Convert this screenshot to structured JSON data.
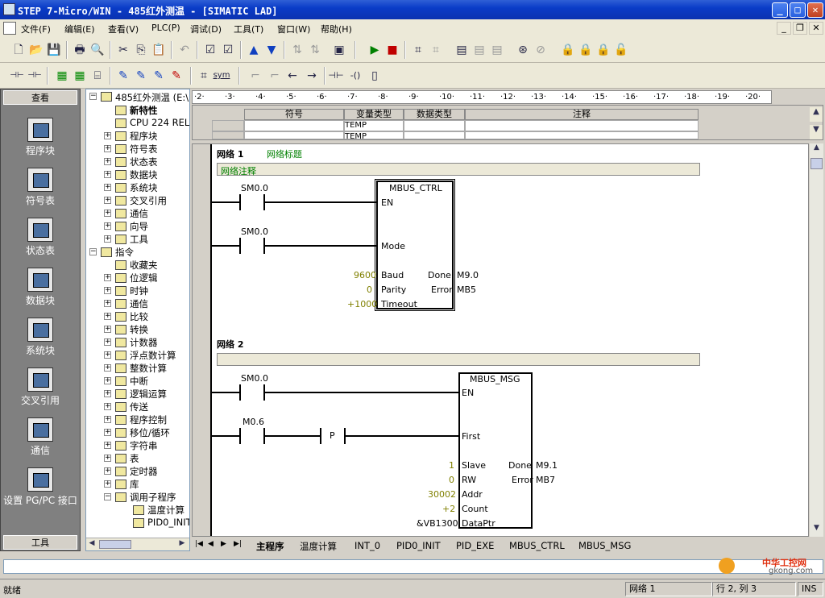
{
  "window": {
    "title": "STEP 7-Micro/WIN - 485红外测温 - [SIMATIC LAD]",
    "min": "_",
    "max": "□",
    "close": "✕"
  },
  "menu": [
    "文件(F)",
    "编辑(E)",
    "查看(V)",
    "PLC(P)",
    "调试(D)",
    "工具(T)",
    "窗口(W)",
    "帮助(H)"
  ],
  "toolbar2": {
    "sym": "sym"
  },
  "nav": {
    "header": "查看",
    "footer": "工具",
    "items": [
      "程序块",
      "符号表",
      "状态表",
      "数据块",
      "系统块",
      "交叉引用",
      "通信",
      "设置 PG/PC 接口"
    ]
  },
  "tree": {
    "root": "485红外测温 (E:\\",
    "items": [
      "新特性",
      "CPU 224 REL",
      "程序块",
      "符号表",
      "状态表",
      "数据块",
      "系统块",
      "交叉引用",
      "通信",
      "向导",
      "工具",
      "指令",
      "收藏夹",
      "位逻辑",
      "时钟",
      "通信",
      "比较",
      "转换",
      "计数器",
      "浮点数计算",
      "整数计算",
      "中断",
      "逻辑运算",
      "传送",
      "程序控制",
      "移位/循环",
      "字符串",
      "表",
      "定时器",
      "库",
      "调用子程序",
      "温度计算",
      "PID0_INIT"
    ]
  },
  "ruler": [
    "·2·",
    "·3·",
    "·4·",
    "·5·",
    "·6·",
    "·7·",
    "·8·",
    "·9·",
    "·10·",
    "·11·",
    "·12·",
    "·13·",
    "·14·",
    "·15·",
    "·16·",
    "·17·",
    "·18·",
    "·19·",
    "·20·"
  ],
  "symtable": {
    "headers": [
      "符号",
      "变量类型",
      "数据类型",
      "注释"
    ],
    "rows": [
      [
        "",
        "TEMP",
        "",
        ""
      ],
      [
        "",
        "TEMP",
        "",
        ""
      ]
    ]
  },
  "network1": {
    "label": "网络 1",
    "title": "网络标题",
    "comment": "网络注释",
    "contact1": "SM0.0",
    "contact2": "SM0.0",
    "block": "MBUS_CTRL",
    "en": "EN",
    "mode": "Mode",
    "baud": "Baud",
    "parity": "Parity",
    "timeout": "Timeout",
    "done": "Done",
    "error": "Error",
    "baud_val": "9600",
    "parity_val": "0",
    "timeout_val": "+1000",
    "done_out": "M9.0",
    "error_out": "MB5"
  },
  "network2": {
    "label": "网络 2",
    "contact1": "SM0.0",
    "contact2": "M0.6",
    "pcoil": "P",
    "block": "MBUS_MSG",
    "en": "EN",
    "first": "First",
    "slave": "Slave",
    "rw": "RW",
    "addr": "Addr",
    "count": "Count",
    "dataptr": "DataPtr",
    "slave_val": "1",
    "rw_val": "0",
    "addr_val": "30002",
    "count_val": "+2",
    "dataptr_val": "&VB1300",
    "done": "Done",
    "error": "Error",
    "done_out": "M9.1",
    "error_out": "MB7"
  },
  "tabs": [
    "主程序",
    "温度计算",
    "INT_0",
    "PID0_INIT",
    "PID_EXE",
    "MBUS_CTRL",
    "MBUS_MSG"
  ],
  "status": {
    "ready": "就绪",
    "network": "网络 1",
    "pos": "行 2, 列 3",
    "ins": "INS"
  },
  "logo": {
    "text": "中华工控网",
    "url": "gkong.com"
  }
}
